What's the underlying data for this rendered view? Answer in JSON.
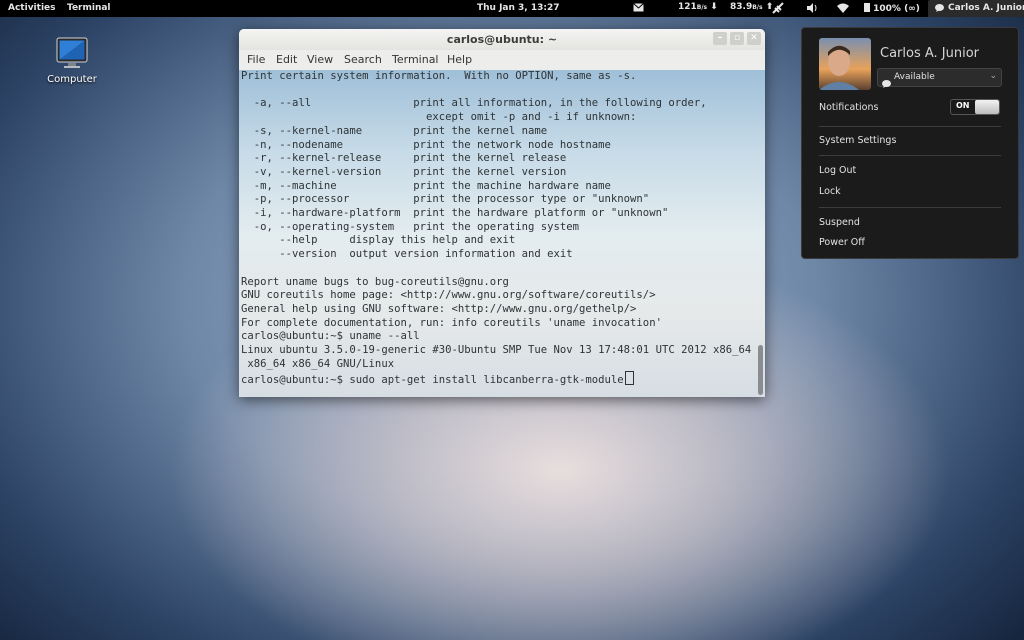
{
  "topbar": {
    "activities": "Activities",
    "app_name": "Terminal",
    "clock": "Thu Jan  3, 13:27",
    "net_down": "121",
    "net_down_unit": "B/s",
    "net_up": "83.9",
    "net_up_unit": "B/s",
    "battery": "100% (∞)",
    "user": "Carlos A. Junior"
  },
  "desktop": {
    "icon_label": "Computer"
  },
  "terminal": {
    "title": "carlos@ubuntu: ~",
    "menu": [
      "File",
      "Edit",
      "View",
      "Search",
      "Terminal",
      "Help"
    ],
    "lines": [
      "Print certain system information.  With no OPTION, same as -s.",
      "",
      "  -a, --all                print all information, in the following order,",
      "                             except omit -p and -i if unknown:",
      "  -s, --kernel-name        print the kernel name",
      "  -n, --nodename           print the network node hostname",
      "  -r, --kernel-release     print the kernel release",
      "  -v, --kernel-version     print the kernel version",
      "  -m, --machine            print the machine hardware name",
      "  -p, --processor          print the processor type or \"unknown\"",
      "  -i, --hardware-platform  print the hardware platform or \"unknown\"",
      "  -o, --operating-system   print the operating system",
      "      --help     display this help and exit",
      "      --version  output version information and exit",
      "",
      "Report uname bugs to bug-coreutils@gnu.org",
      "GNU coreutils home page: <http://www.gnu.org/software/coreutils/>",
      "General help using GNU software: <http://www.gnu.org/gethelp/>",
      "For complete documentation, run: info coreutils 'uname invocation'",
      "carlos@ubuntu:~$ uname --all",
      "Linux ubuntu 3.5.0-19-generic #30-Ubuntu SMP Tue Nov 13 17:48:01 UTC 2012 x86_64",
      " x86_64 x86_64 GNU/Linux",
      "carlos@ubuntu:~$ sudo apt-get install libcanberra-gtk-module"
    ]
  },
  "user_panel": {
    "name": "Carlos A. Junior",
    "status": "Available",
    "notifications_label": "Notifications",
    "notifications_state": "ON",
    "system_settings": "System Settings",
    "log_out": "Log Out",
    "lock": "Lock",
    "suspend": "Suspend",
    "power_off": "Power Off"
  }
}
